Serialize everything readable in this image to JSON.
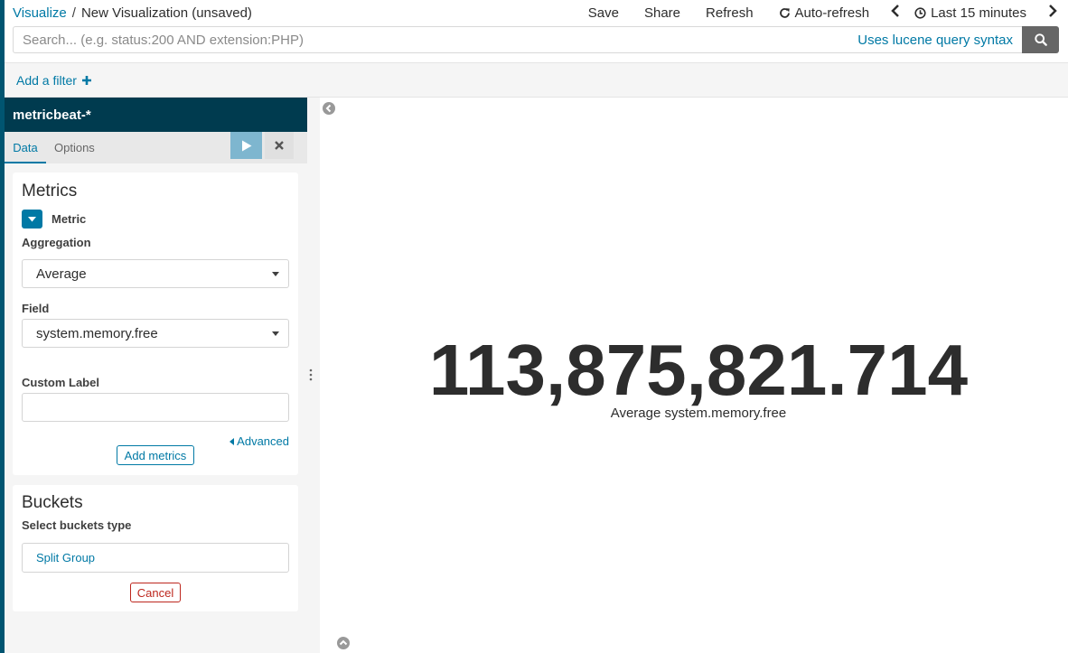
{
  "breadcrumb": {
    "root": "Visualize",
    "separator": "/",
    "current": "New Visualization (unsaved)"
  },
  "topnav": {
    "save": "Save",
    "share": "Share",
    "refresh": "Refresh",
    "auto_refresh": "Auto-refresh",
    "time_range": "Last 15 minutes"
  },
  "search": {
    "placeholder": "Search... (e.g. status:200 AND extension:PHP)",
    "value": "",
    "syntax_link": "Uses lucene query syntax"
  },
  "filter": {
    "add_label": "Add a filter"
  },
  "sidebar": {
    "index_pattern": "metricbeat-*",
    "tabs": [
      "Data",
      "Options"
    ],
    "metrics": {
      "title": "Metrics",
      "metric_label": "Metric",
      "aggregation_label": "Aggregation",
      "aggregation_value": "Average",
      "field_label": "Field",
      "field_value": "system.memory.free",
      "custom_label_label": "Custom Label",
      "custom_label_value": "",
      "advanced": "Advanced",
      "add_metrics": "Add metrics"
    },
    "buckets": {
      "title": "Buckets",
      "select_type_label": "Select buckets type",
      "split_group": "Split Group",
      "cancel": "Cancel"
    }
  },
  "visualization": {
    "value": "113,875,821.714",
    "label": "Average system.memory.free"
  },
  "colors": {
    "accent": "#0079a5",
    "index_header": "#003b4f",
    "danger": "#bd271e"
  }
}
